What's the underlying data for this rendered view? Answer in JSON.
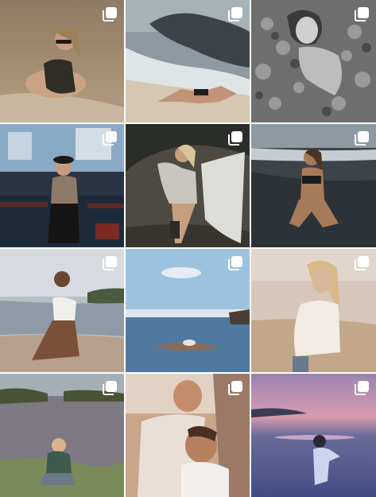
{
  "posts": [
    {
      "id": "p1",
      "icon": "multiple-photos-icon",
      "colors": [
        "#8f7a63",
        "#b9a88f",
        "#c8b79e"
      ]
    },
    {
      "id": "p2",
      "icon": "multiple-photos-icon",
      "colors": [
        "#3d4346",
        "#8d9aa0",
        "#d6c6b2"
      ]
    },
    {
      "id": "p3",
      "icon": "multiple-photos-icon",
      "colors": [
        "#3a3a3a",
        "#7b7b7b",
        "#bdbdbd"
      ]
    },
    {
      "id": "p4",
      "icon": "multiple-photos-icon",
      "colors": [
        "#1d2a3a",
        "#8aa9c5",
        "#5a2a22"
      ]
    },
    {
      "id": "p5",
      "icon": "multiple-photos-icon",
      "colors": [
        "#2b2d2a",
        "#4d4a43",
        "#dcdcd8"
      ]
    },
    {
      "id": "p6",
      "icon": "multiple-photos-icon",
      "colors": [
        "#8e9aa2",
        "#3c4448",
        "#2c3236"
      ]
    },
    {
      "id": "p7",
      "icon": "multiple-photos-icon",
      "colors": [
        "#d7dbe0",
        "#8e9aa6",
        "#b7a08c"
      ]
    },
    {
      "id": "p8",
      "icon": "multiple-photos-icon",
      "colors": [
        "#9cc3dd",
        "#4f7aa0",
        "#5c6a78"
      ]
    },
    {
      "id": "p9",
      "icon": "multiple-photos-icon",
      "colors": [
        "#d6c7b8",
        "#c2a78a",
        "#f1ece6"
      ]
    },
    {
      "id": "p10",
      "icon": "multiple-photos-icon",
      "colors": [
        "#a6aeb5",
        "#6a6f57",
        "#7a8a5a"
      ]
    },
    {
      "id": "p11",
      "icon": "multiple-photos-icon",
      "colors": [
        "#caa58a",
        "#9a7a66",
        "#e8dfd8"
      ]
    },
    {
      "id": "p12",
      "icon": "multiple-photos-icon",
      "colors": [
        "#b58fb0",
        "#6a6c9a",
        "#3f4d84"
      ]
    }
  ]
}
